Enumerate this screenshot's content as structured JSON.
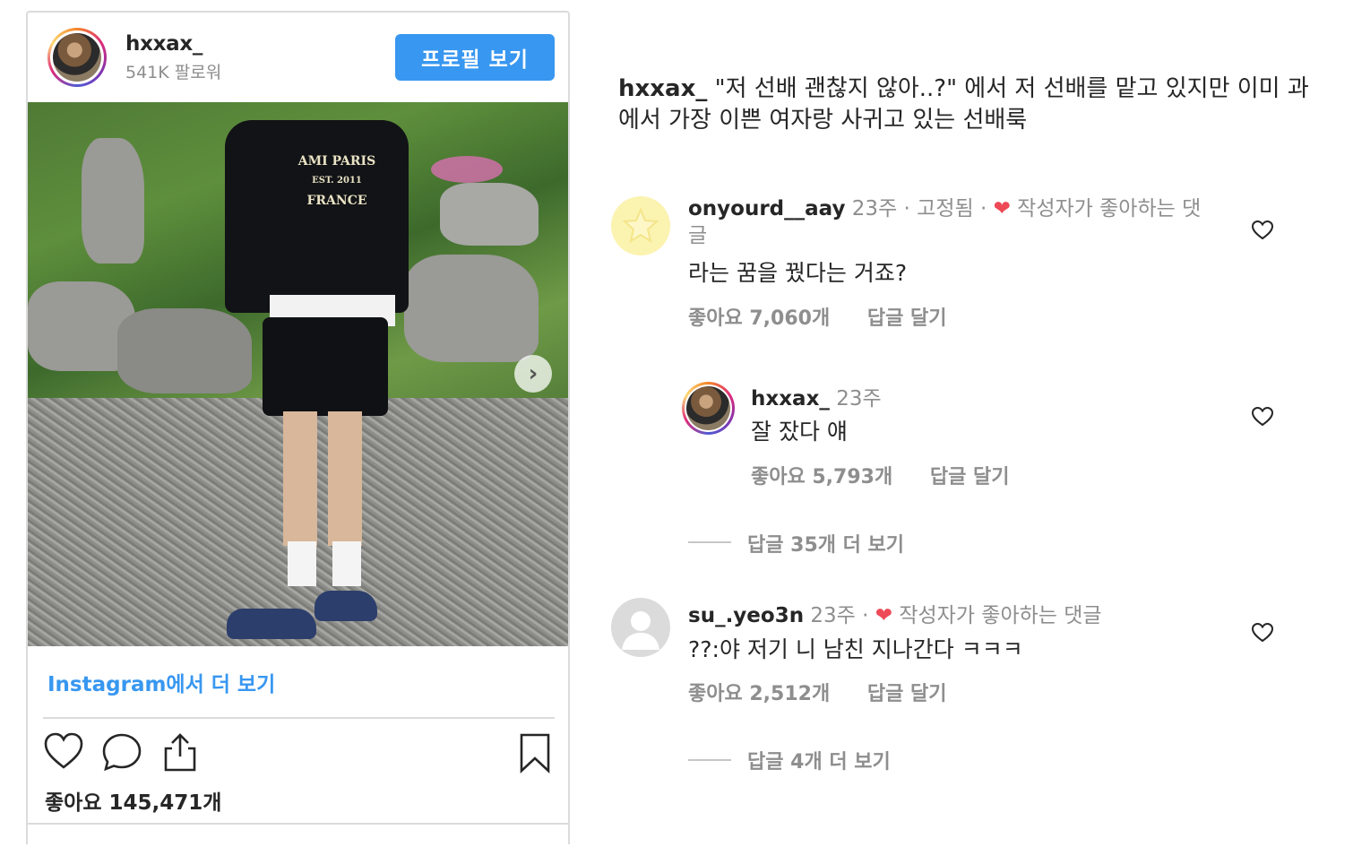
{
  "embed": {
    "username": "hxxax_",
    "followers": "541K 팔로워",
    "profile_button": "프로필 보기",
    "photo_logo": [
      "AMI PARIS",
      "EST. 2011",
      "FRANCE"
    ],
    "next_arrow": "›",
    "view_more": "Instagram에서 더 보기",
    "likes": "좋아요 145,471개"
  },
  "caption": {
    "username": "hxxax_",
    "text": "\"저 선배 괜찮지 않아..?\" 에서 저 선배를 맡고 있지만 이미 과에서 가장 이쁜 여자랑 사귀고 있는 선배룩"
  },
  "comments": [
    {
      "username": "onyourd__aay",
      "meta": "23주 · 고정됨 ·",
      "liked_by_author": "작성자가 좋아하는 댓글",
      "text": "라는 꿈을 꿨다는 거죠?",
      "likes": "좋아요 7,060개",
      "reply": "답글 달기"
    },
    {
      "username": "hxxax_",
      "meta": "23주",
      "text": "잘 잤다 얘",
      "likes": "좋아요 5,793개",
      "reply": "답글 달기"
    },
    {
      "username": "su_.yeo3n",
      "meta": "23주 ·",
      "liked_by_author": "작성자가 좋아하는 댓글",
      "text": "??:야 저기 니 남친 지나간다 ㅋㅋㅋ",
      "likes": "좋아요 2,512개",
      "reply": "답글 달기"
    }
  ],
  "view_replies": [
    "답글 35개 더 보기",
    "답글 4개 더 보기"
  ],
  "colors": {
    "accent": "#3897f0",
    "heart": "#ed4956",
    "muted": "#8e8e8e",
    "text": "#262626"
  }
}
